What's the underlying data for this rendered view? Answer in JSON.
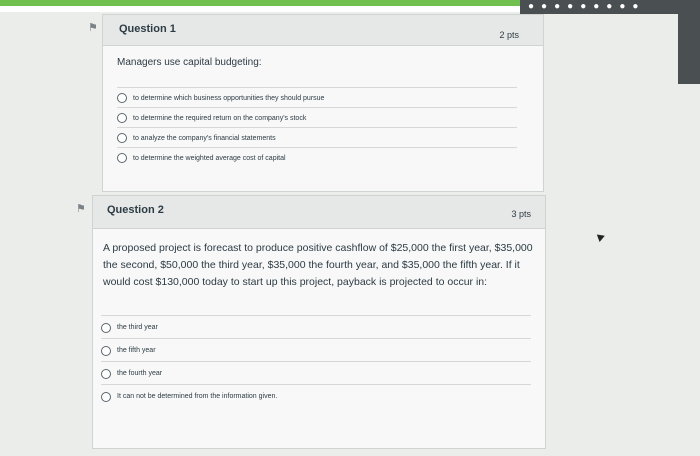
{
  "q1": {
    "title": "Question 1",
    "points": "2 pts",
    "prompt": "Managers use capital budgeting:",
    "options": [
      "to determine which business opportunities they should pursue",
      "to determine the required return on the company's stock",
      "to analyze the company's financial statements",
      "to determine the weighted average cost of capital"
    ]
  },
  "q2": {
    "title": "Question 2",
    "points": "3 pts",
    "prompt": "A proposed project is forecast to produce positive cashflow of $25,000 the first year, $35,000 the second, $50,000 the third year, $35,000 the fourth year, and $35,000 the fifth year. If it would cost $130,000 today to start up this project, payback is projected to occur in:",
    "options": [
      "the third year",
      "the fifth year",
      "the fourth year",
      "It can not be determined from the information given."
    ]
  }
}
